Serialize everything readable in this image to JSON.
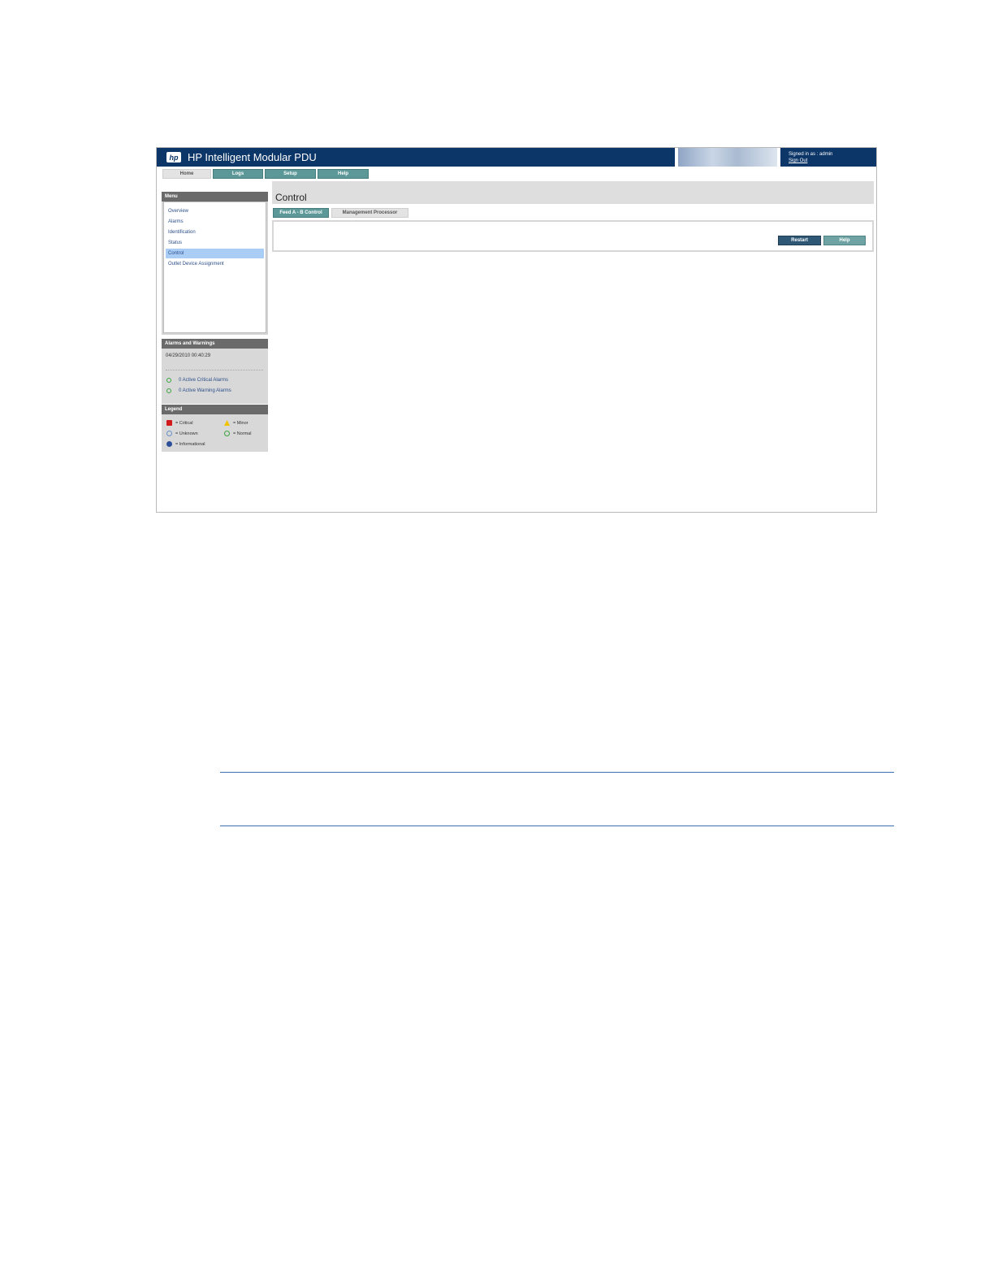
{
  "banner": {
    "logo": "hp",
    "title": "HP Intelligent Modular PDU",
    "signed_in": "Signed in as : admin",
    "sign_out": "Sign Out"
  },
  "top_tabs": [
    "Home",
    "Logs",
    "Setup",
    "Help"
  ],
  "sidebar": {
    "menu_header": "Menu",
    "menu_items": [
      "Overview",
      "Alarms",
      "Identification",
      "Status",
      "Control",
      "Outlet Device Assignment"
    ],
    "alarms_header": "Alarms and Warnings",
    "timestamp": "04/29/2010 00:40:29",
    "alarms": [
      "0 Active Critical Alarms",
      "0 Active Warning Alarms"
    ],
    "legend_header": "Legend",
    "legend": {
      "critical": "= Critical",
      "minor": "= Minor",
      "unknown": "= Unknown",
      "normal": "= Normal",
      "informational": "= Informational"
    }
  },
  "content": {
    "title": "Control",
    "tabs": [
      "Feed A - B Control",
      "Management Processor"
    ],
    "buttons": {
      "restart": "Restart",
      "help": "Help"
    }
  },
  "colors": {
    "banner": "#0c3568",
    "tab_teal": "#5d9898",
    "menu_highlight": "#a9cdf5",
    "rule": "#3b6fae"
  }
}
